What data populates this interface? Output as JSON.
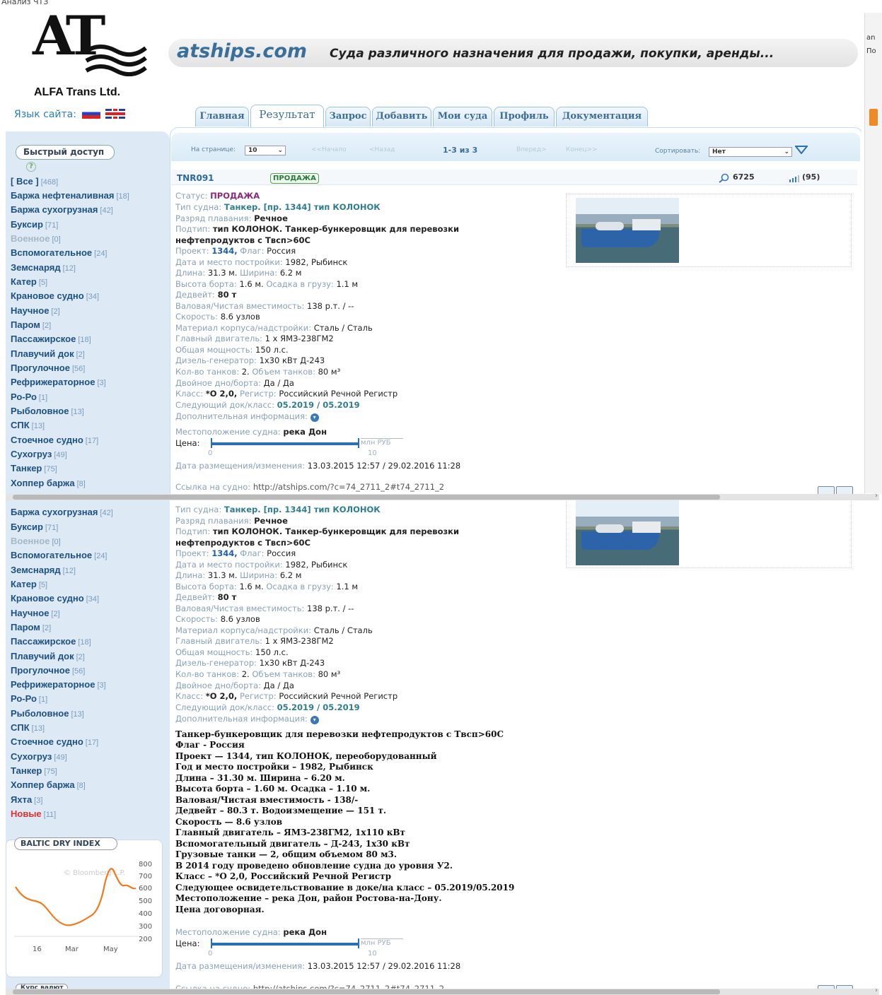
{
  "caption": "Анализ ЧТЗ",
  "header": {
    "logo_letters": "AT",
    "logo_name": "ALFA Trans Ltd.",
    "lang_label": "Язык сайта:",
    "site": "atships.com",
    "slogan": "Суда различного назначения для продажи, покупки, аренды..."
  },
  "tabs": [
    "Главная",
    "Результат",
    "Запрос",
    "Добавить",
    "Мои суда",
    "Профиль",
    "Документация"
  ],
  "sidebar": {
    "quick_access": "Быстрый доступ",
    "help": "?",
    "categories": [
      {
        "label": "[ Все ]",
        "count": "[468]"
      },
      {
        "label": "Баржа нефтеналивная",
        "count": "[18]"
      },
      {
        "label": "Баржа сухогрузная",
        "count": "[42]"
      },
      {
        "label": "Буксир",
        "count": "[71]"
      },
      {
        "label": "Военное",
        "count": "[0]"
      },
      {
        "label": "Вспомогательное",
        "count": "[24]"
      },
      {
        "label": "Земснаряд",
        "count": "[12]"
      },
      {
        "label": "Катер",
        "count": "[5]"
      },
      {
        "label": "Крановое судно",
        "count": "[34]"
      },
      {
        "label": "Научное",
        "count": "[2]"
      },
      {
        "label": "Паром",
        "count": "[2]"
      },
      {
        "label": "Пассажирское",
        "count": "[18]"
      },
      {
        "label": "Плавучий док",
        "count": "[2]"
      },
      {
        "label": "Прогулочное",
        "count": "[56]"
      },
      {
        "label": "Рефрижераторное",
        "count": "[3]"
      },
      {
        "label": "Ро-Ро",
        "count": "[1]"
      },
      {
        "label": "Рыболовное",
        "count": "[13]"
      },
      {
        "label": "СПК",
        "count": "[13]"
      },
      {
        "label": "Стоечное судно",
        "count": "[17]"
      },
      {
        "label": "Сухогруз",
        "count": "[49]"
      },
      {
        "label": "Танкер",
        "count": "[75]"
      },
      {
        "label": "Хоппер баржа",
        "count": "[8]"
      },
      {
        "label": "Яхта",
        "count": "[3]"
      },
      {
        "label": "Новые",
        "count": "[11]"
      }
    ],
    "bdi": {
      "title": "BALTIC DRY INDEX",
      "watermark": "© Bloomberg L.P.",
      "y_ticks": [
        "800",
        "700",
        "600",
        "500",
        "400",
        "300",
        "200"
      ],
      "x_ticks": [
        "16",
        "Mar",
        "May"
      ],
      "line_color": "#f07a20"
    },
    "kurs_label": "Курс валют"
  },
  "toolbar": {
    "per_page_label": "На странице:",
    "per_page_value": "10",
    "first": "<<Начало",
    "prev": "<Назад",
    "range": "1-3 из 3",
    "next": "Вперед>",
    "last": "Конец>>",
    "sort_label": "Сортировать:",
    "sort_value": "Нет"
  },
  "listing": {
    "code": "TNR091",
    "badge": "ПРОДАЖА",
    "views": "6725",
    "rating": "(95)",
    "status_label": "Статус:",
    "status_value": "ПРОДАЖА",
    "type_label": "Тип судна:",
    "type_value": "Танкер. [пр. 1344] тип КОЛОНОК",
    "class_label": "Разряд плавания:",
    "class_value": "Речное",
    "subtype_label": "Подтип:",
    "subtype_value": "тип КОЛОНОК. Танкер-бункеровщик для перевозки",
    "subtype_value2": "нефтепродуктов с Твсп>60С",
    "project_label": "Проект:",
    "project_value": "1344,",
    "flag_label": "Флаг:",
    "flag_value": "Россия",
    "built_label": "Дата и место постройки:",
    "built_value": "1982, Рыбинск",
    "length_label": "Длина:",
    "length_value": "31.3 м.",
    "width_label": "Ширина:",
    "width_value": "6.2 м",
    "height_label": "Высота борта:",
    "height_value": "1.6 м.",
    "draft_label": "Осадка в грузу:",
    "draft_value": "1.1 м",
    "dwt_label": "Дедвейт:",
    "dwt_value": "80 т",
    "tonnage_label": "Валовая/Чистая вместимость:",
    "tonnage_value": "138 р.т. / --",
    "speed_label": "Скорость:",
    "speed_value": "8.6 узлов",
    "material_label": "Материал корпуса/надстройки:",
    "material_value": "Сталь / Сталь",
    "engine_label": "Главный двигатель:",
    "engine_value": "1 x ЯМЗ-238ГМ2",
    "power_label": "Общая мощность:",
    "power_value": "150 л.с.",
    "gen_label": "Дизель-генератор:",
    "gen_value": "1х30 кВт Д-243",
    "tanks_label": "Кол-во танков:",
    "tanks_value": "2.",
    "tanks_vol_label": "Объем танков:",
    "tanks_vol_value": "80 м³",
    "double_label": "Двойное дно/борта:",
    "double_value": "Да / Да",
    "klass_label": "Класс:",
    "klass_value": "*О 2,0,",
    "register_label": "Регистр:",
    "register_value": "Российский Речной Регистр",
    "next_dock_label": "Следующий док/класс:",
    "next_dock_value": "05.2019 / 05.2019",
    "extra_label": "Дополнительная информация:",
    "location_label": "Местоположение судна:",
    "location_value": "река Дон",
    "price_label": "Цена:",
    "price_unit": "млн РУБ",
    "price_min": "0",
    "price_max": "10",
    "price_level": 0.98,
    "date_label": "Дата размещения/изменения:",
    "date_value": "13.03.2015 12:57 / 29.02.2016 11:28",
    "link_label": "Ссылка на судно:",
    "link_value": "http://atships.com/?c=74_2711_2#t74_2711_2",
    "extra_text": [
      "Танкер-бункеровщик для перевозки нефтепродуктов с Твсп>60С",
      "Флаг - Россия",
      "Проект — 1344, тип КОЛОНОК, переоборудованный",
      "Год и место постройки – 1982, Рыбинск",
      "Длина – 31.30 м. Ширина – 6.20 м.",
      "Высота борта – 1.60 м. Осадка – 1.10 м.",
      "Валовая/Чистая вместимость - 138/-",
      "Дедвейт – 80.3 т. Водоизмещение — 151 т.",
      "Скорость — 8.6 узлов",
      "Главный двигатель – ЯМЗ-238ГМ2, 1х110 кВт",
      "Вспомогательный двигатель – Д-243, 1х30 кВт",
      "Грузовые танки — 2, общим объемом 80 м3.",
      "В 2014 году проведено обновление судна до уровня У2.",
      "Класс – *О 2,0, Российский Речной Регистр",
      "Следующее освидетельствование в доке/на класс – 05.2019/05.2019",
      "Местоположение – река Дон, район Ростова-на-Дону.",
      "Цена договорная."
    ]
  },
  "right_strip": {
    "line1": "an",
    "line2": "По"
  }
}
